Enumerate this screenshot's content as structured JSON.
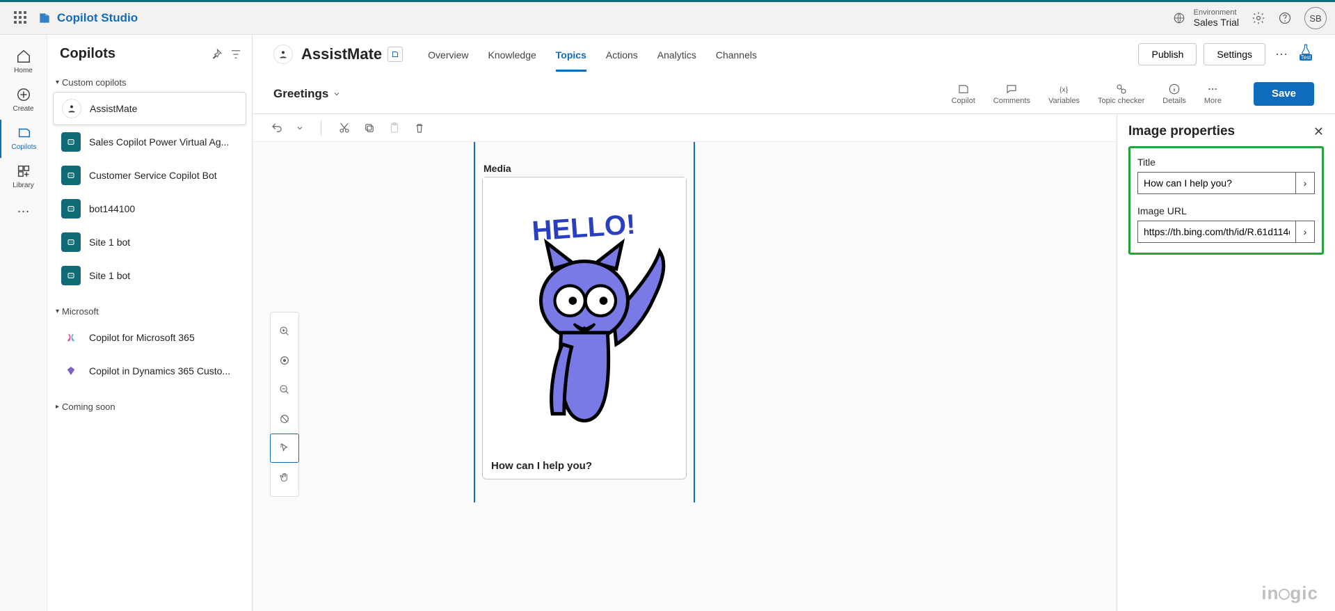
{
  "topbar": {
    "brand": "Copilot Studio",
    "env_label": "Environment",
    "env_name": "Sales Trial",
    "avatar_initials": "SB"
  },
  "rail": {
    "items": [
      {
        "label": "Home"
      },
      {
        "label": "Create"
      },
      {
        "label": "Copilots"
      },
      {
        "label": "Library"
      }
    ]
  },
  "panel": {
    "title": "Copilots",
    "sections": {
      "custom_title": "Custom copilots",
      "msft_title": "Microsoft",
      "coming_title": "Coming soon"
    },
    "custom": [
      {
        "label": "AssistMate"
      },
      {
        "label": "Sales Copilot Power Virtual Ag..."
      },
      {
        "label": "Customer Service Copilot Bot"
      },
      {
        "label": "bot144100"
      },
      {
        "label": "Site 1 bot"
      },
      {
        "label": "Site 1 bot"
      }
    ],
    "msft": [
      {
        "label": "Copilot for Microsoft 365"
      },
      {
        "label": "Copilot in Dynamics 365 Custo..."
      }
    ]
  },
  "main": {
    "bot_name": "AssistMate",
    "tabs": [
      "Overview",
      "Knowledge",
      "Topics",
      "Actions",
      "Analytics",
      "Channels"
    ],
    "active_tab": "Topics",
    "publish_label": "Publish",
    "settings_label": "Settings",
    "test_label": "Test"
  },
  "topic": {
    "name": "Greetings",
    "tools": [
      "Copilot",
      "Comments",
      "Variables",
      "Topic checker",
      "Details",
      "More"
    ],
    "save_label": "Save"
  },
  "node": {
    "type": "Media",
    "caption": "How can I help you?",
    "hello_text": "HELLO!"
  },
  "props": {
    "pane_title": "Image properties",
    "title_label": "Title",
    "title_value": "How can I help you?",
    "url_label": "Image URL",
    "url_value": "https://th.bing.com/th/id/R.61d114dc..."
  },
  "watermark": "inogic"
}
